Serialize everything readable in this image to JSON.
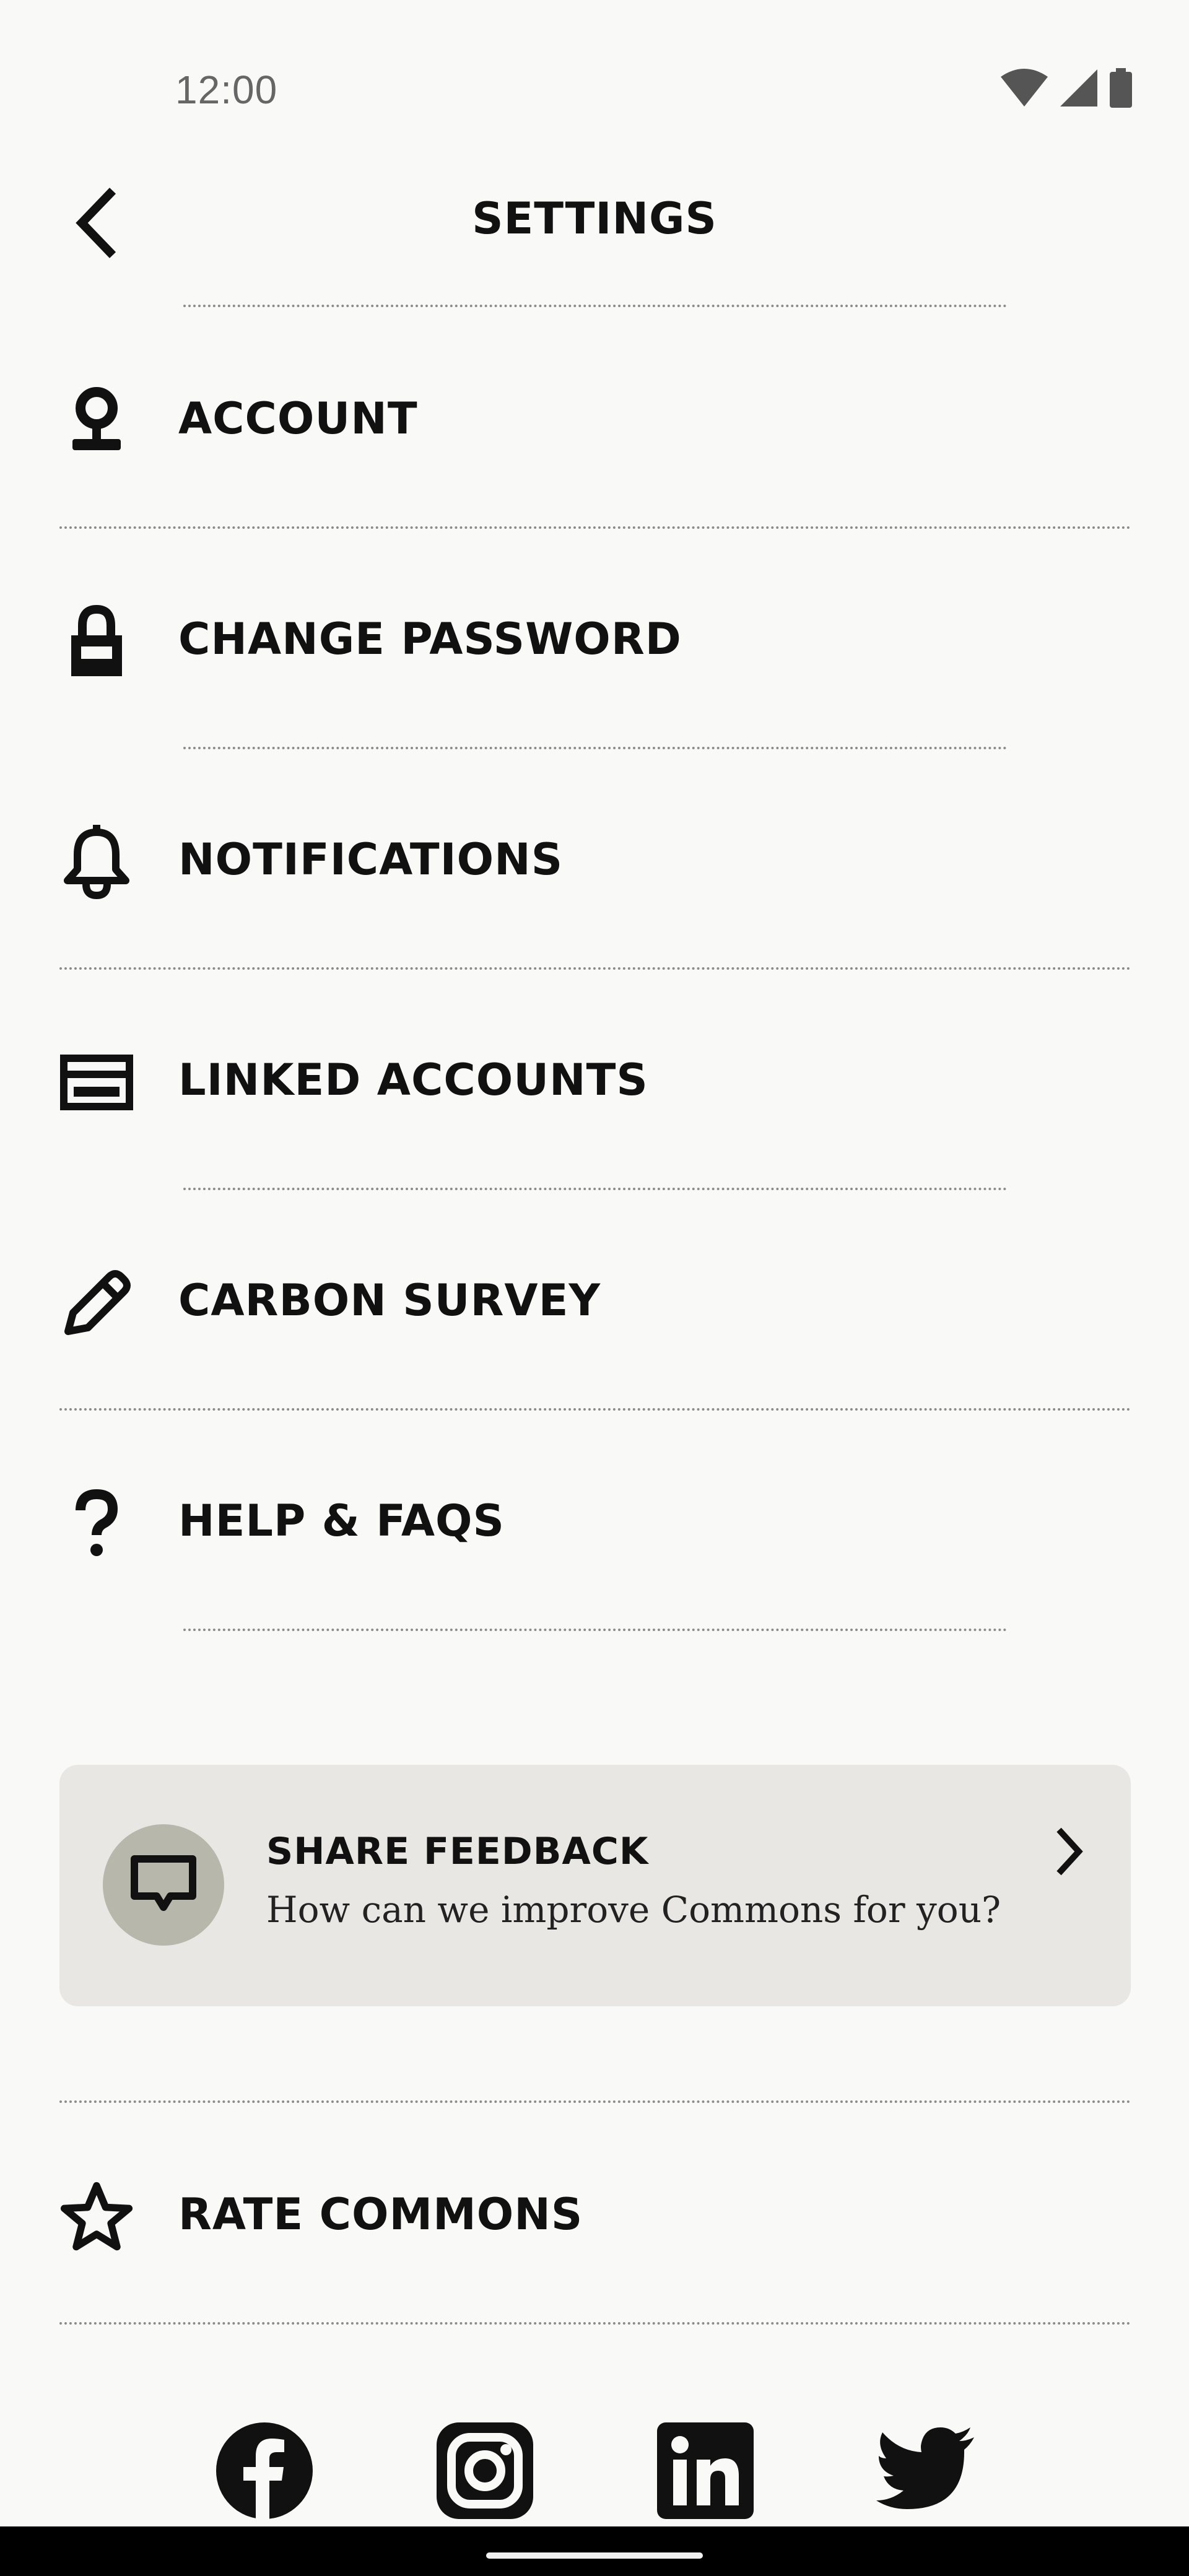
{
  "status_bar": {
    "time": "12:00"
  },
  "header": {
    "title": "SETTINGS"
  },
  "menu": {
    "items": [
      {
        "label": "ACCOUNT",
        "icon": "account-pin-icon"
      },
      {
        "label": "CHANGE PASSWORD",
        "icon": "lock-icon"
      },
      {
        "label": "NOTIFICATIONS",
        "icon": "bell-icon"
      },
      {
        "label": "LINKED ACCOUNTS",
        "icon": "credit-card-icon"
      },
      {
        "label": "CARBON SURVEY",
        "icon": "pencil-icon"
      },
      {
        "label": "HELP & FAQS",
        "icon": "question-mark-icon"
      }
    ]
  },
  "feedback": {
    "title": "SHARE FEEDBACK",
    "subtitle": "How can we improve Commons for you?",
    "icon": "chat-bubble-icon"
  },
  "rate": {
    "label": "RATE COMMONS",
    "icon": "star-icon"
  },
  "social": [
    "facebook-icon",
    "instagram-icon",
    "linkedin-icon",
    "twitter-icon"
  ],
  "colors": {
    "background": "#f9f9f8",
    "card": "#e8e7e3",
    "avatar": "#b8b7ab",
    "text": "#111111"
  }
}
